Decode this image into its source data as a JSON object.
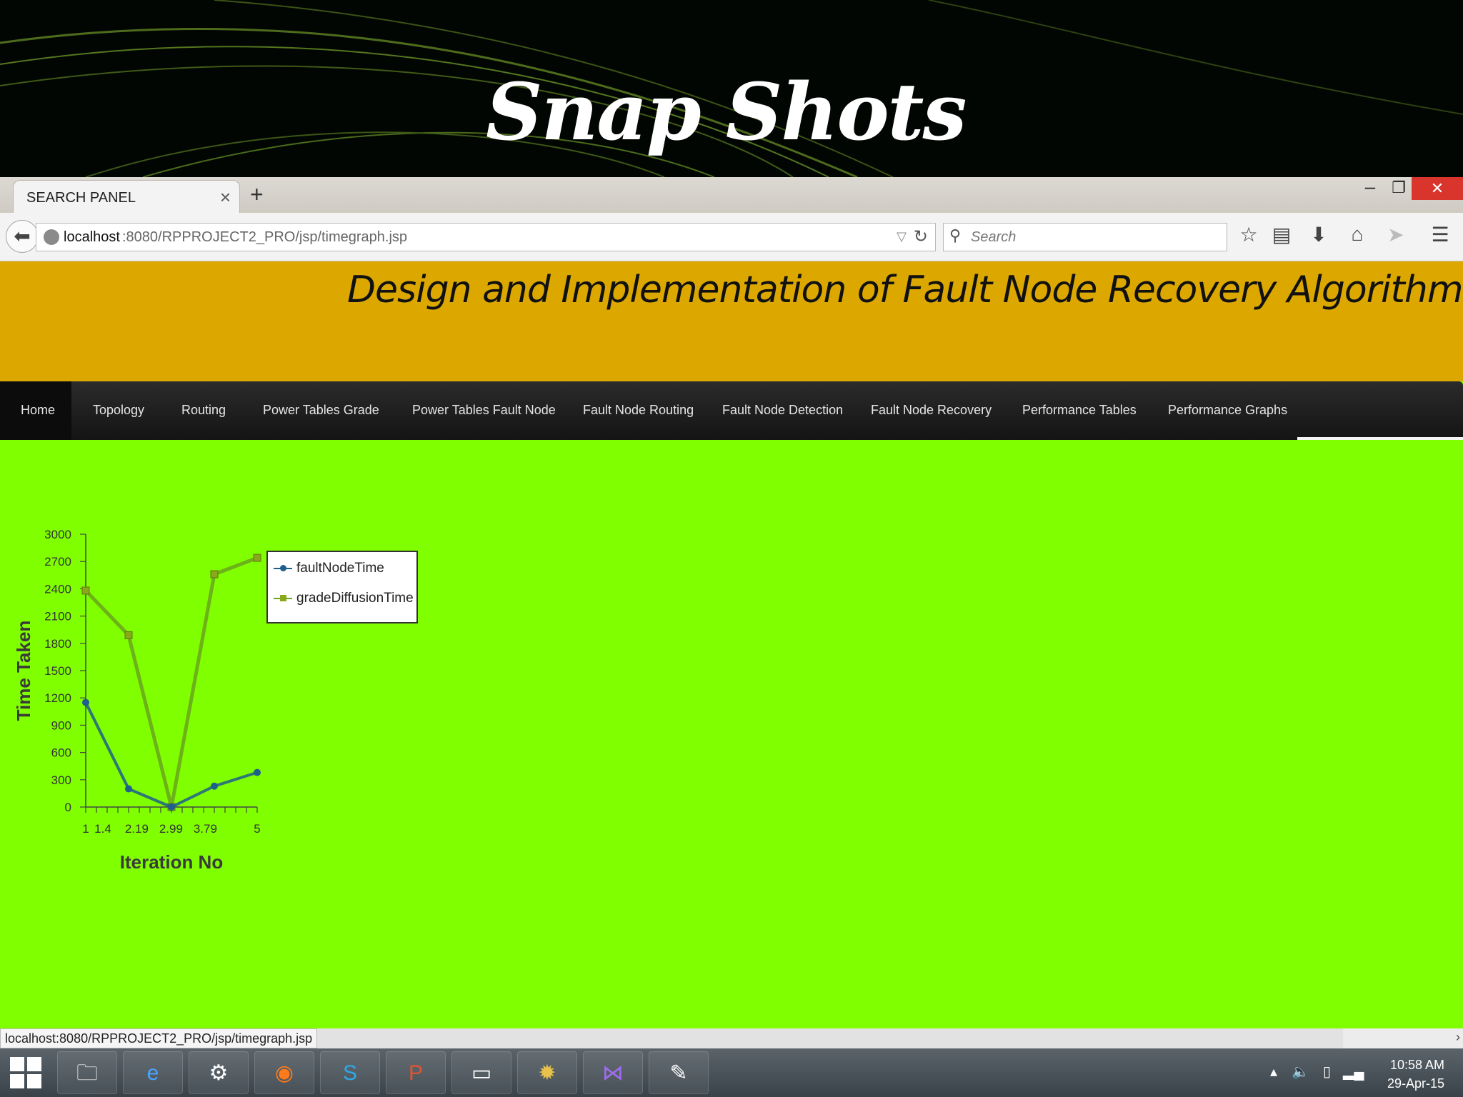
{
  "slide": {
    "title": "Snap Shots"
  },
  "browser": {
    "tab_title": "SEARCH PANEL",
    "tab_close": "×",
    "new_tab": "+",
    "url_host": "localhost",
    "url_path": ":8080/RPPROJECT2_PRO/jsp/timegraph.jsp",
    "search_placeholder": "Search",
    "status_url": "localhost:8080/RPPROJECT2_PRO/jsp/timegraph.jsp"
  },
  "page": {
    "header_title": "Design and Implementation of Fault Node Recovery Algorithm",
    "menu": [
      {
        "label": "Home"
      },
      {
        "label": "Topology"
      },
      {
        "label": "Routing"
      },
      {
        "label": "Power Tables Grade"
      },
      {
        "label": "Power Tables Fault Node"
      },
      {
        "label": "Fault Node Routing"
      },
      {
        "label": "Fault Node Detection"
      },
      {
        "label": "Fault Node Recovery"
      },
      {
        "label": "Performance Tables"
      },
      {
        "label": "Performance Graphs"
      }
    ]
  },
  "chart_data": {
    "type": "line",
    "xlabel": "Iteration No",
    "ylabel": "Time Taken",
    "xlim": [
      1,
      5
    ],
    "ylim": [
      0,
      3000
    ],
    "x_ticks": [
      "1",
      "1.4",
      "2.19",
      "2.99",
      "3.79",
      "5"
    ],
    "y_ticks": [
      0,
      300,
      600,
      900,
      1200,
      1500,
      1800,
      2100,
      2400,
      2700,
      3000
    ],
    "x": [
      1,
      2,
      3,
      4,
      5
    ],
    "series": [
      {
        "name": "faultNodeTime",
        "values": [
          1150,
          200,
          0,
          230,
          380
        ],
        "color": "#1f5f8b"
      },
      {
        "name": "gradeDiffusionTime",
        "values": [
          2380,
          1890,
          0,
          2560,
          2740
        ],
        "color": "#6aa51c"
      }
    ],
    "legend": "right"
  },
  "taskbar": {
    "time": "10:58 AM",
    "date": "29-Apr-15"
  }
}
